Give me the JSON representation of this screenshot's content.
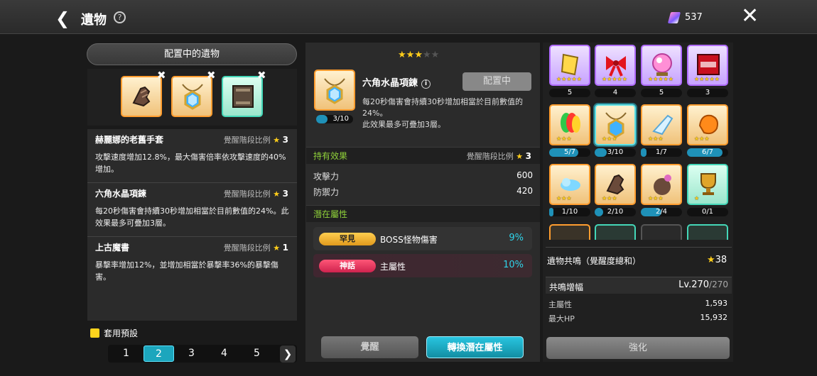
{
  "header": {
    "title": "遺物",
    "help_label": "?",
    "currency_value": "537"
  },
  "left": {
    "heading": "配置中的遺物",
    "relics": [
      {
        "name": "赫麗娜的老舊手套",
        "ratio_label": "覺醒階段比例",
        "ratio": "3",
        "description": "攻擊速度增加12.8%，最大傷害倍率依攻擊速度的40%增加。"
      },
      {
        "name": "六角水晶項鍊",
        "ratio_label": "覺醒階段比例",
        "ratio": "3",
        "description": "每20秒傷害會持續30秒增加相當於目前數值的24%。此效果最多可疊加3層。"
      },
      {
        "name": "上古魔書",
        "ratio_label": "覺醒階段比例",
        "ratio": "1",
        "description": "暴擊率增加12%，並增加相當於暴擊率36%的暴擊傷害。"
      }
    ],
    "preset_label": "套用預設",
    "pages": [
      "1",
      "2",
      "3",
      "4",
      "5"
    ],
    "active_page": "2"
  },
  "detail": {
    "star_rating": 3,
    "star_max": 5,
    "item_name": "六角水晶項鍊",
    "info_label": "i",
    "deploy_label": "配置中",
    "progress_label": "3/10",
    "progress_fraction": 0.3,
    "description_line1": "每20秒傷害會持續30秒增加相當於目前數值的",
    "description_line2": "24%。",
    "description_line3": "此效果最多可疊加3層。",
    "held_effects_label": "持有效果",
    "ratio_label": "覺醒階段比例",
    "ratio": "3",
    "stats": [
      {
        "name": "攻擊力",
        "value": "600"
      },
      {
        "name": "防禦力",
        "value": "420"
      }
    ],
    "potential_label": "潛在屬性",
    "potentials": [
      {
        "grade": "罕見",
        "name": "BOSS怪物傷害",
        "value": "9%",
        "grade_color": "#e8a21c",
        "value_color": "#2fd4ea"
      },
      {
        "grade": "神話",
        "name": "主屬性",
        "value": "10%",
        "grade_color": "#e3305c",
        "value_color": "#2fd4ea"
      }
    ],
    "awaken_button": "覺醒",
    "convert_button": "轉換潛在屬性"
  },
  "collection": {
    "counts": [
      "5",
      "4",
      "5",
      "3",
      "5/7",
      "3/10",
      "1/7",
      "6/7",
      "1/10",
      "2/10",
      "2/4",
      "0/1"
    ],
    "resonance_label": "遺物共鳴（覺醒度總和）",
    "resonance_value": "38",
    "amp_label": "共鳴增幅",
    "amp_level": "Lv.270",
    "amp_max": "/270",
    "stats": [
      {
        "name": "主屬性",
        "value": "1,593"
      },
      {
        "name": "最大HP",
        "value": "15,932"
      }
    ],
    "strength_button": "強化"
  },
  "colors": {
    "accent": "#1ca6bd",
    "star": "#ffcd1a",
    "highlight_green": "#8fd13a"
  },
  "icons": [
    "back-icon",
    "help-icon",
    "crystal-icon",
    "close-icon",
    "glove-icon",
    "necklace-icon",
    "book-icon",
    "scroll-icon",
    "bow-icon",
    "orb-icon",
    "box-icon",
    "feather-icon",
    "slipper-icon",
    "stone-icon",
    "cloud-icon",
    "bag-icon",
    "trophy-icon"
  ]
}
